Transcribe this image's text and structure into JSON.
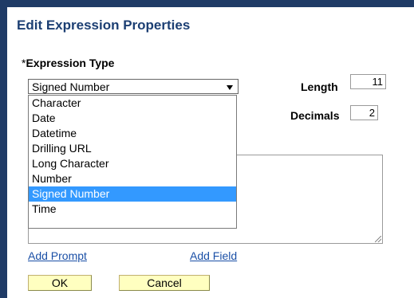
{
  "dialog": {
    "title": "Edit Expression Properties"
  },
  "expression_type": {
    "required_marker": "*",
    "label": "Expression Type",
    "selected": "Signed Number",
    "options": [
      "Character",
      "Date",
      "Datetime",
      "Drilling URL",
      "Long Character",
      "Number",
      "Signed Number",
      "Time"
    ]
  },
  "length": {
    "label": "Length",
    "value": "11"
  },
  "decimals": {
    "label": "Decimals",
    "value": "2"
  },
  "links": {
    "add_prompt": "Add Prompt",
    "add_field": "Add Field"
  },
  "buttons": {
    "ok": "OK",
    "cancel": "Cancel"
  },
  "colors": {
    "background_frame": "#1f3b66",
    "title": "#1c3f73",
    "selected_option": "#3399ff",
    "button_fill": "#ffffc0",
    "link": "#1a4fa6"
  },
  "icons": {
    "select_arrow": "chevron-down-icon",
    "resize": "resize-grip-icon"
  }
}
